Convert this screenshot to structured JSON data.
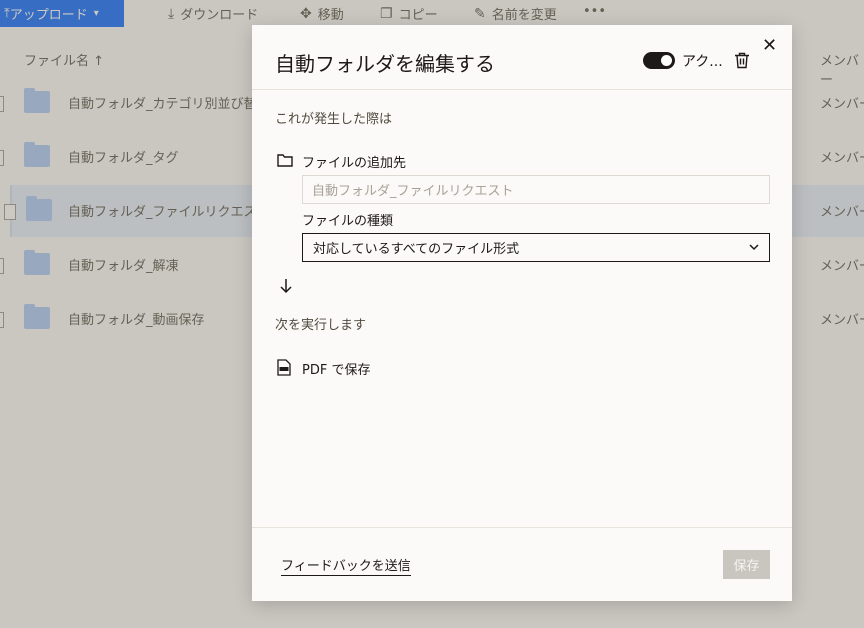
{
  "toolbar": {
    "upload_label": "アップロード",
    "download_label": "ダウンロード",
    "move_label": "移動",
    "copy_label": "コピー",
    "rename_label": "名前を変更",
    "more_label": "•••"
  },
  "file_list": {
    "col_name": "ファイル名 ↑",
    "col_access": "メンバー",
    "rows": [
      {
        "name": "自動フォルダ_カテゴリ別並び替",
        "member": "メンバー"
      },
      {
        "name": "自動フォルダ_タグ",
        "member": "メンバー"
      },
      {
        "name": "自動フォルダ_ファイルリクエス",
        "member": "メンバー"
      },
      {
        "name": "自動フォルダ_解凍",
        "member": "メンバー"
      },
      {
        "name": "自動フォルダ_動画保存",
        "member": "メンバー"
      }
    ]
  },
  "modal": {
    "title": "自動フォルダを編集する",
    "toggle_label": "アク...",
    "toggle_on": true,
    "trigger_heading": "これが発生した際は",
    "destination_label": "ファイルの追加先",
    "destination_value": "自動フォルダ_ファイルリクエスト",
    "filetype_label": "ファイルの種類",
    "filetype_value": "対応しているすべてのファイル形式",
    "action_heading": "次を実行します",
    "action_label": "PDF で保存",
    "feedback_label": "フィードバックを送信",
    "save_label": "保存"
  },
  "icons": {
    "close": "close-icon",
    "trash": "trash-icon",
    "folder": "folder-icon",
    "arrow": "arrow-down-icon",
    "pdf": "pdf-file-icon",
    "chevron": "chevron-down-icon"
  },
  "colors": {
    "accent": "#0061fe",
    "text": "#1e1919",
    "save_disabled": "#c9c5bf"
  }
}
